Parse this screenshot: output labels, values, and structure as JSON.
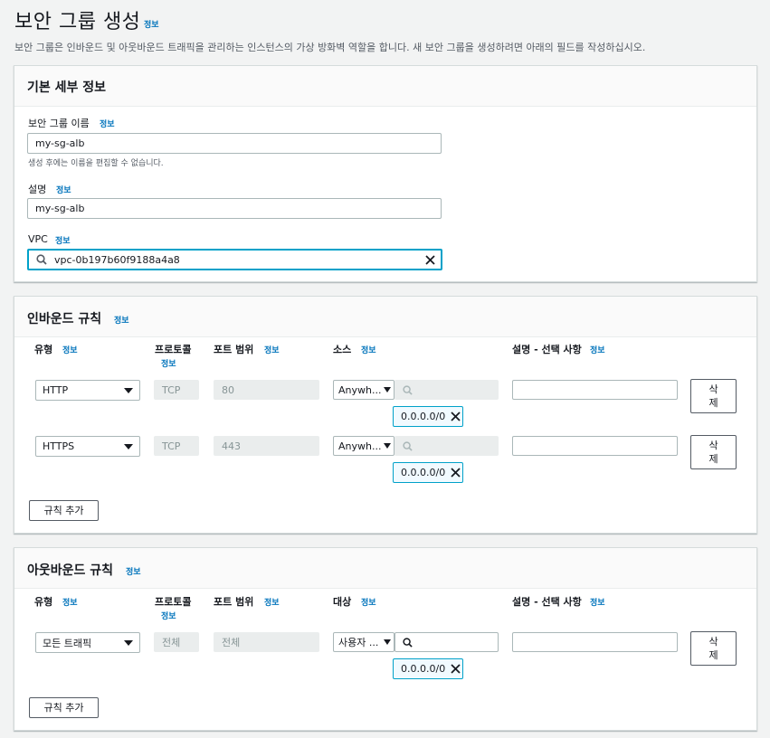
{
  "page": {
    "title": "보안 그룹 생성",
    "info": "정보",
    "description": "보안 그룹은 인바운드 및 아웃바운드 트래픽을 관리하는 인스턴스의 가상 방화벽 역할을 합니다. 새 보안 그룹을 생성하려면 아래의 필드를 작성하십시오."
  },
  "basic": {
    "title": "기본 세부 정보",
    "name_label": "보안 그룹 이름",
    "name_info": "정보",
    "name_value": "my-sg-alb",
    "name_hint": "생성 후에는 이름을 편집할 수 없습니다.",
    "desc_label": "설명",
    "desc_info": "정보",
    "desc_value": "my-sg-alb",
    "vpc_label": "VPC",
    "vpc_info": "정보",
    "vpc_value": "vpc-0b197b60f9188a4a8"
  },
  "inbound": {
    "title": "인바운드 규칙",
    "info": "정보",
    "columns": {
      "type": "유형",
      "type_info": "정보",
      "protocol": "프로토콜",
      "protocol_info": "정보",
      "port": "포트 범위",
      "port_info": "정보",
      "source": "소스",
      "source_info": "정보",
      "desc": "설명 - 선택 사항",
      "desc_info": "정보"
    },
    "rules": [
      {
        "type": "HTTP",
        "protocol": "TCP",
        "port": "80",
        "source": "Anywh...",
        "cidr": "0.0.0.0/0",
        "delete": "삭\n제"
      },
      {
        "type": "HTTPS",
        "protocol": "TCP",
        "port": "443",
        "source": "Anywh...",
        "cidr": "0.0.0.0/0",
        "delete": "삭\n제"
      }
    ],
    "add_rule": "규칙 추가"
  },
  "outbound": {
    "title": "아웃바운드 규칙",
    "info": "정보",
    "columns": {
      "type": "유형",
      "type_info": "정보",
      "protocol": "프로토콜",
      "protocol_info": "정보",
      "port": "포트 범위",
      "port_info": "정보",
      "dest": "대상",
      "dest_info": "정보",
      "desc": "설명 - 선택 사항",
      "desc_info": "정보"
    },
    "rules": [
      {
        "type": "모든 트래픽",
        "protocol": "전체",
        "port": "전체",
        "dest": "사용자 ...",
        "cidr": "0.0.0.0/0",
        "delete": "삭\n제"
      }
    ],
    "add_rule": "규칙 추가"
  },
  "icons": {
    "search": "search-icon",
    "clear": "close-icon",
    "dropdown": "caret-down-icon",
    "remove_token": "close-icon"
  },
  "colors": {
    "link": "#0073bb",
    "focus": "#00a1c9",
    "token_bg": "#f1faff"
  }
}
